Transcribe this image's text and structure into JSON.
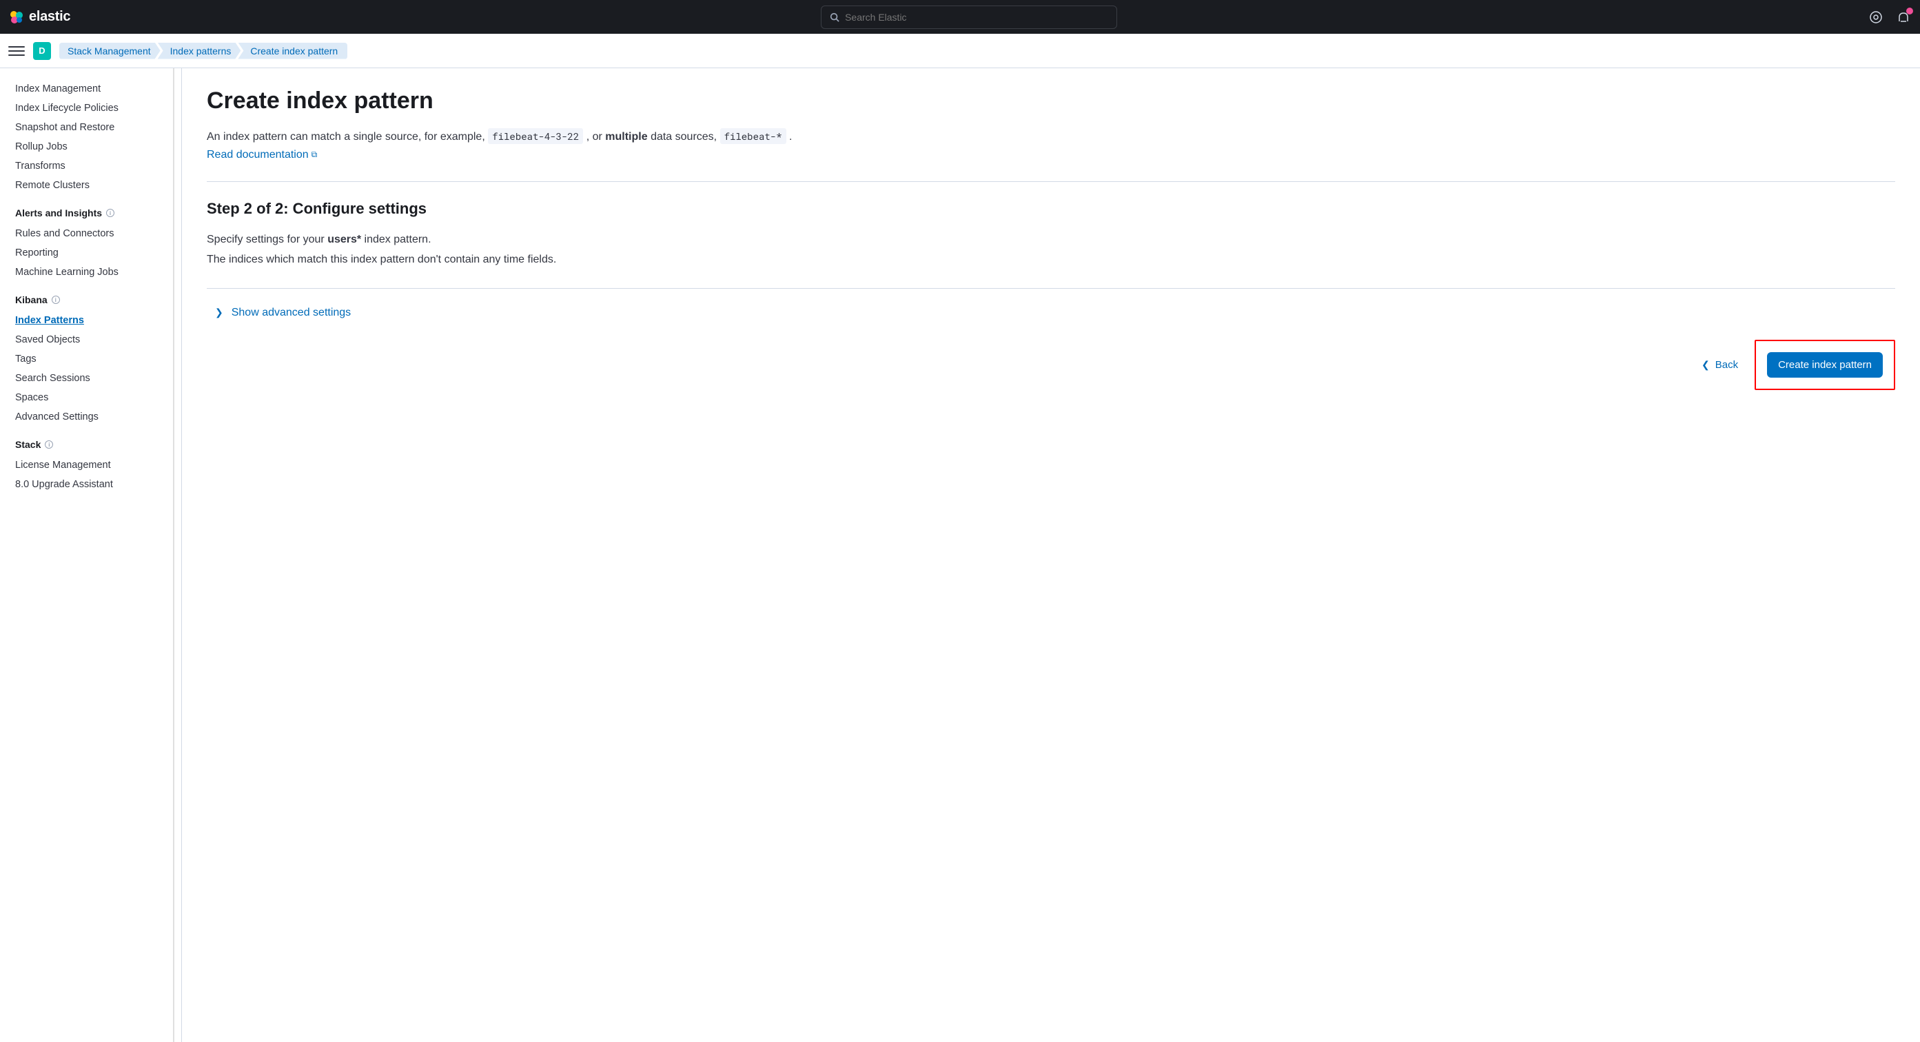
{
  "header": {
    "brand": "elastic",
    "search_placeholder": "Search Elastic",
    "avatar_initial": "D"
  },
  "breadcrumbs": [
    "Stack Management",
    "Index patterns",
    "Create index pattern"
  ],
  "sidebar": {
    "top_items": [
      "Index Management",
      "Index Lifecycle Policies",
      "Snapshot and Restore",
      "Rollup Jobs",
      "Transforms",
      "Remote Clusters"
    ],
    "sections": [
      {
        "title": "Alerts and Insights",
        "items": [
          "Rules and Connectors",
          "Reporting",
          "Machine Learning Jobs"
        ]
      },
      {
        "title": "Kibana",
        "items": [
          "Index Patterns",
          "Saved Objects",
          "Tags",
          "Search Sessions",
          "Spaces",
          "Advanced Settings"
        ],
        "active_index": 0
      },
      {
        "title": "Stack",
        "items": [
          "License Management",
          "8.0 Upgrade Assistant"
        ]
      }
    ]
  },
  "main": {
    "title": "Create index pattern",
    "intro_prefix": "An index pattern can match a single source, for example, ",
    "code_example_1": "filebeat-4-3-22",
    "intro_mid": " , or ",
    "intro_bold": "multiple",
    "intro_suffix": " data sources, ",
    "code_example_2": "filebeat-*",
    "intro_tail": " .",
    "doc_link": "Read documentation",
    "step_title": "Step 2 of 2: Configure settings",
    "specify_prefix": "Specify settings for your ",
    "specify_bold": "users*",
    "specify_suffix": " index pattern.",
    "no_time_fields": "The indices which match this index pattern don't contain any time fields.",
    "advanced_toggle": "Show advanced settings",
    "back_label": "Back",
    "create_button": "Create index pattern"
  }
}
